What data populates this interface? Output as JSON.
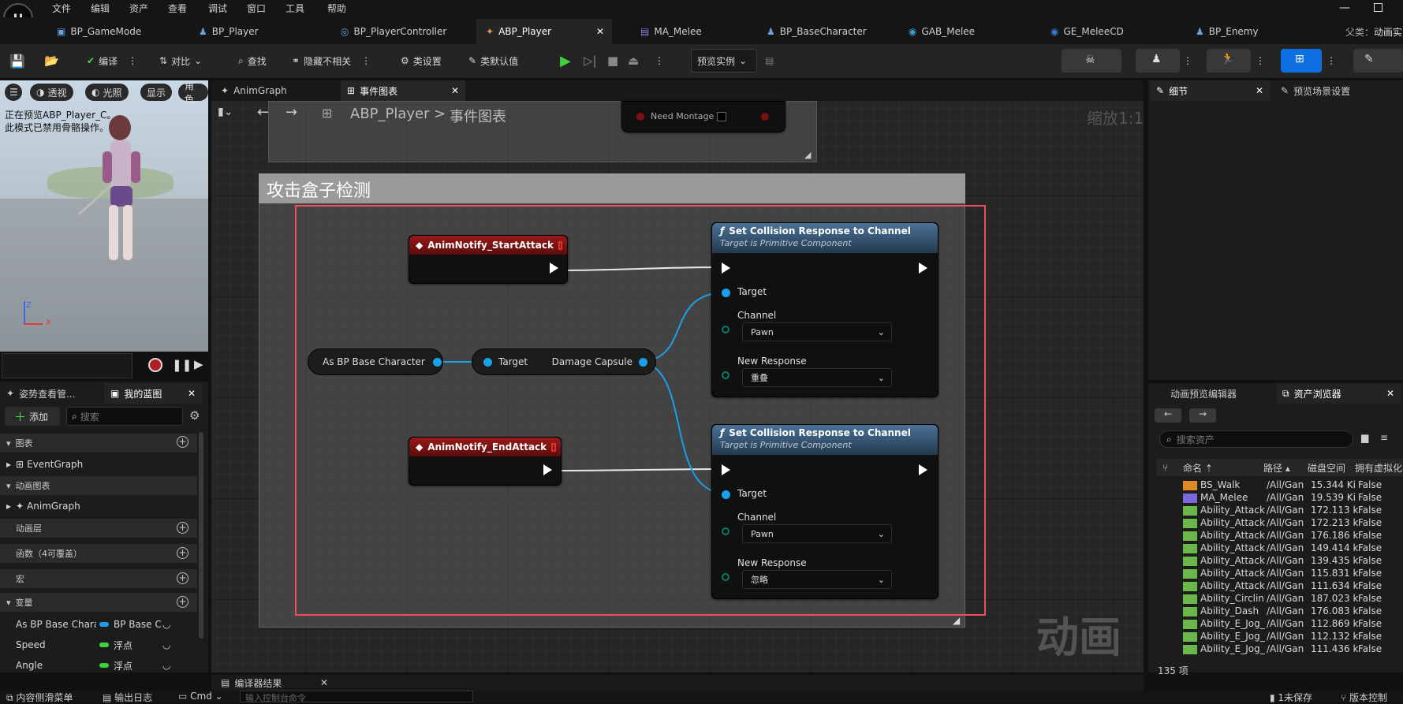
{
  "menu": [
    "文件",
    "编辑",
    "资产",
    "查看",
    "调试",
    "窗口",
    "工具",
    "帮助"
  ],
  "doc_tabs": [
    "BP_GameMode",
    "BP_Player",
    "BP_PlayerController",
    "ABP_Player",
    "MA_Melee",
    "BP_BaseCharacter",
    "GAB_Melee",
    "GE_MeleeCD",
    "BP_Enemy"
  ],
  "parent_label": "父类：",
  "parent_value": "动画实",
  "toolbar": {
    "compile": "编译",
    "diff": "对比",
    "find": "查找",
    "hide": "隐藏不相关",
    "class_settings": "类设置",
    "class_defaults": "类默认值",
    "preview": "预览实例"
  },
  "viewport": {
    "perspective": "透视",
    "lit": "光照",
    "show": "显示",
    "role": "角色",
    "notice1": "正在预览ABP_Player_C。",
    "notice2": "此模式已禁用骨骼操作。",
    "axis_z": "Z",
    "axis_x": "X"
  },
  "left_panel": {
    "tab_pose": "姿势查看管...",
    "tab_mybp": "我的蓝图",
    "add": "添加",
    "search_placeholder": "搜索",
    "sec_graph": "图表",
    "event_graph": "EventGraph",
    "sec_anim": "动画图表",
    "anim_graph": "AnimGraph",
    "sec_layers": "动画层",
    "sec_funcs": "函数（4可覆盖）",
    "sec_macros": "宏",
    "sec_vars": "变量",
    "vars": [
      {
        "name": "As BP Base Characte",
        "type": "BP Base C",
        "color": "#1aa0e8"
      },
      {
        "name": "Speed",
        "type": "浮点",
        "color": "#3cd23c"
      },
      {
        "name": "Angle",
        "type": "浮点",
        "color": "#3cd23c"
      }
    ]
  },
  "graph": {
    "tab_anim": "AnimGraph",
    "tab_event": "事件图表",
    "crumb_root": "ABP_Player",
    "crumb_sep": ">",
    "crumb_leaf": "事件图表",
    "zoom": "缩放1:1",
    "need_montage": "Need Montage",
    "comment": "攻击盒子检测",
    "watermark": "动画",
    "start_event": "AnimNotify_StartAttack",
    "end_event": "AnimNotify_EndAttack",
    "cast_node": "As BP Base Character",
    "getter_target": "Target",
    "getter_out": "Damage Capsule",
    "fn_nodes": [
      {
        "title": "Set Collision Response to Channel",
        "subtitle": "Target is Primitive Component",
        "target": "Target",
        "channel_label": "Channel",
        "channel": "Pawn",
        "response_label": "New Response",
        "response": "重叠"
      },
      {
        "title": "Set Collision Response to Channel",
        "subtitle": "Target is Primitive Component",
        "target": "Target",
        "channel_label": "Channel",
        "channel": "Pawn",
        "response_label": "New Response",
        "response": "忽略"
      }
    ]
  },
  "right_panel": {
    "tab_details": "细节",
    "tab_preview": "预览场景设置",
    "tab_anim_editor": "动画预览编辑器",
    "tab_assets": "资产浏览器",
    "search_placeholder": "搜索资产",
    "columns": [
      "命名",
      "路径",
      "磁盘空间",
      "拥有虚拟化"
    ],
    "rows": [
      {
        "name": "BS_Walk",
        "path": "/All/Gan",
        "size": "15.344 Ki",
        "virt": "False",
        "color": "#e08a2a"
      },
      {
        "name": "MA_Melee",
        "path": "/All/Gan",
        "size": "19.539 Ki",
        "virt": "False",
        "color": "#7a6ad8"
      },
      {
        "name": "Ability_Attack",
        "path": "/All/Gan",
        "size": "172.113 k",
        "virt": "False",
        "color": "#6ab84a"
      },
      {
        "name": "Ability_Attack",
        "path": "/All/Gan",
        "size": "172.213 k",
        "virt": "False",
        "color": "#6ab84a"
      },
      {
        "name": "Ability_Attack",
        "path": "/All/Gan",
        "size": "176.186 k",
        "virt": "False",
        "color": "#6ab84a"
      },
      {
        "name": "Ability_Attack",
        "path": "/All/Gan",
        "size": "149.414 k",
        "virt": "False",
        "color": "#6ab84a"
      },
      {
        "name": "Ability_Attack",
        "path": "/All/Gan",
        "size": "139.435 k",
        "virt": "False",
        "color": "#6ab84a"
      },
      {
        "name": "Ability_Attack",
        "path": "/All/Gan",
        "size": "115.831 k",
        "virt": "False",
        "color": "#6ab84a"
      },
      {
        "name": "Ability_Attack",
        "path": "/All/Gan",
        "size": "111.634 k",
        "virt": "False",
        "color": "#6ab84a"
      },
      {
        "name": "Ability_Circlin",
        "path": "/All/Gan",
        "size": "187.023 k",
        "virt": "False",
        "color": "#6ab84a"
      },
      {
        "name": "Ability_Dash",
        "path": "/All/Gan",
        "size": "176.083 k",
        "virt": "False",
        "color": "#6ab84a"
      },
      {
        "name": "Ability_E_Jog_",
        "path": "/All/Gan",
        "size": "112.869 k",
        "virt": "False",
        "color": "#6ab84a"
      },
      {
        "name": "Ability_E_Jog_",
        "path": "/All/Gan",
        "size": "112.132 k",
        "virt": "False",
        "color": "#6ab84a"
      },
      {
        "name": "Ability_E_Jog_",
        "path": "/All/Gan",
        "size": "111.436 k",
        "virt": "False",
        "color": "#6ab84a"
      }
    ],
    "count": "135 项"
  },
  "bottom": {
    "compiler_results": "编译器结果",
    "content_drawer": "内容侧滑菜单",
    "output_log": "输出日志",
    "cmd": "Cmd",
    "console_placeholder": "输入控制台命令",
    "unsaved": "1未保存",
    "source_control": "版本控制"
  }
}
